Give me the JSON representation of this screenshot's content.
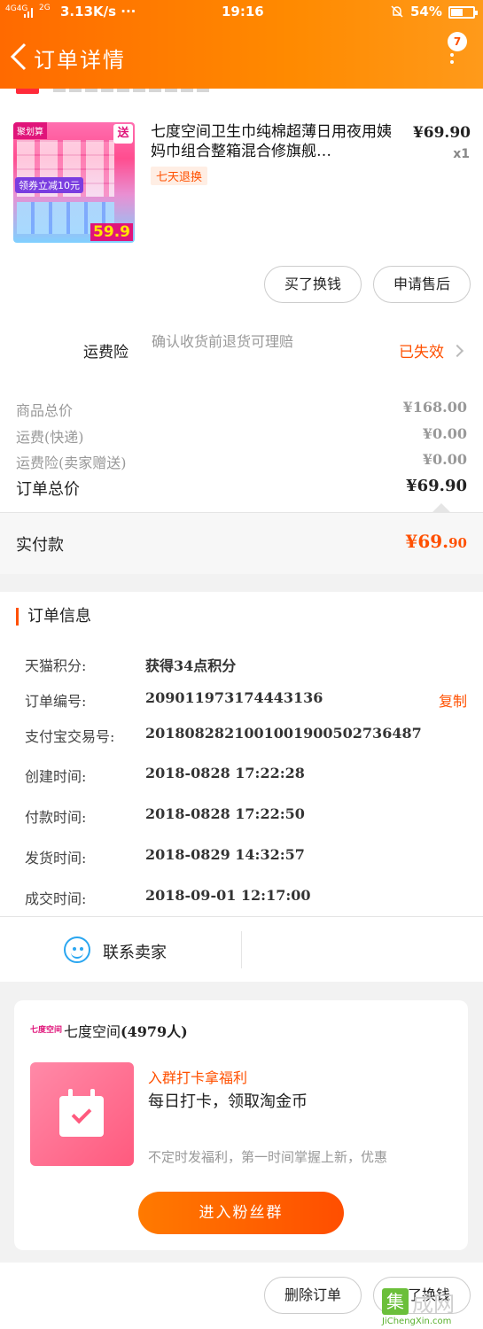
{
  "status_bar": {
    "signal": "4G4G",
    "network": "2G",
    "speed": "3.13K/s ···",
    "time": "19:16",
    "battery": "54%",
    "battery_level": 0.54
  },
  "nav": {
    "title": "订单详情",
    "badge": "7"
  },
  "product": {
    "title": "七度空间卫生巾纯棉超薄日用夜用姨妈巾组合整箱混合修旗舰…",
    "return_tag": "七天退换",
    "price": "¥69.90",
    "qty": "x1",
    "thumb": {
      "sticker": "聚划算",
      "corner": "送",
      "coupon": "领券立减10元",
      "price": "59.9"
    }
  },
  "actions": {
    "buy_again": "买了换钱",
    "after_sale": "申请售后"
  },
  "insurance": {
    "label": "运费险",
    "desc": "确认收货前退货可理赔",
    "status": "已失效"
  },
  "summary": {
    "rows": [
      {
        "label": "商品总价",
        "value": "¥168.00"
      },
      {
        "label": "运费(快递)",
        "value": "¥0.00"
      },
      {
        "label": "运费险(卖家赠送)",
        "value": "¥0.00"
      }
    ],
    "total_label": "订单总价",
    "total_value": "¥69.90"
  },
  "paid": {
    "label": "实付款",
    "value_main": "¥69.",
    "value_cents": "90"
  },
  "order_info": {
    "title": "订单信息",
    "copy_label": "复制",
    "rows": [
      {
        "label": "天猫积分:",
        "value": "获得34点积分"
      },
      {
        "label": "订单编号:",
        "value": "209011973174443136"
      },
      {
        "label": "支付宝交易号:",
        "value": "2018082821001001900502736487"
      },
      {
        "label": "创建时间:",
        "value": "2018-0828 17:22:28"
      },
      {
        "label": "付款时间:",
        "value": "2018-0828 17:22:50"
      },
      {
        "label": "发货时间:",
        "value": "2018-0829 14:32:57"
      },
      {
        "label": "成交时间:",
        "value": "2018-09-01 12:17:00"
      }
    ],
    "contact_label": "联系卖家"
  },
  "group": {
    "logo": "七度空间",
    "name": "七度空间",
    "count": "(4979人)",
    "headline": "入群打卡拿福利",
    "sub": "每日打卡，领取淘金币",
    "desc": "不定时发福利，第一时间掌握上新，优惠",
    "join_label": "进入粉丝群"
  },
  "bottom": {
    "delete_label": "删除订单",
    "buy_again_label": "买了换钱"
  },
  "watermark": {
    "badge": "集",
    "cn": "成网",
    "en": "JiChengXin.com"
  },
  "colors": {
    "accent": "#ff5000",
    "header_start": "#ff6a00",
    "header_end": "#ff9a1a",
    "link_blue": "#2aa6f0"
  }
}
